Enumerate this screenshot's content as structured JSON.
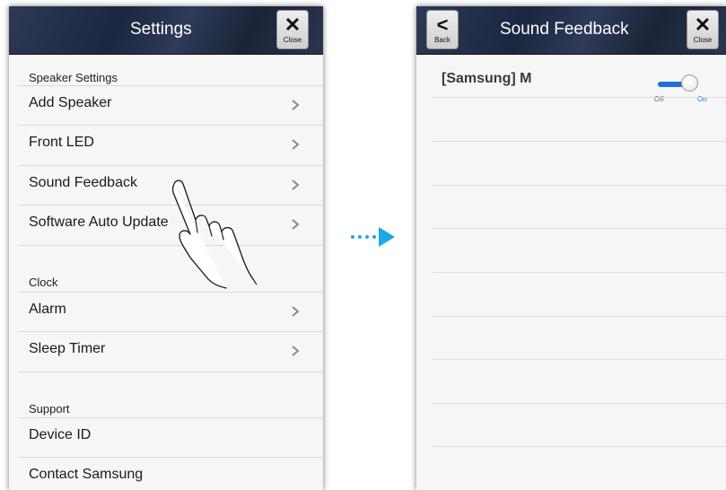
{
  "left_screen": {
    "title": "Settings",
    "close_label": "Close",
    "sections": [
      {
        "header": "Speaker Settings",
        "items": [
          "Add Speaker",
          "Front LED",
          "Sound Feedback",
          "Software Auto Update"
        ]
      },
      {
        "header": "Clock",
        "items": [
          "Alarm",
          "Sleep Timer"
        ]
      },
      {
        "header": "Support",
        "items": [
          "Device ID",
          "Contact Samsung"
        ]
      }
    ]
  },
  "right_screen": {
    "back_label": "Back",
    "title": "Sound Feedback",
    "close_label": "Close",
    "device_name": "[Samsung] M",
    "toggle": {
      "off_label": "Off",
      "on_label": "On",
      "state": "on"
    }
  },
  "icons": {
    "close": "close-icon",
    "back": "back-chevron-icon",
    "row_chevron": "chevron-right-icon",
    "hand_pointer": "hand-pointer-icon",
    "transition_arrow": "dotted-arrow-icon"
  },
  "colors": {
    "navbar": "#1f2a42",
    "accent": "#1f6fd6",
    "transition_arrow": "#1aa8e8",
    "background": "#f6f6f6"
  }
}
